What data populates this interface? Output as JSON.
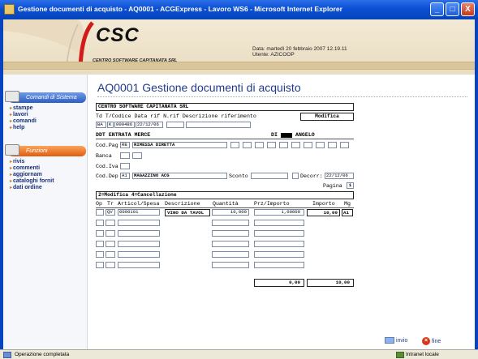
{
  "window": {
    "title": "Gestione documenti di acquisto - AQ0001 - ACGExpress - Lavoro WS6 - Microsoft Internet Explorer",
    "minimize": "_",
    "maximize": "□",
    "close": "X"
  },
  "header": {
    "logo": "CSC",
    "logo_sub": "CENTRO SOFTWARE CAPITANATA SRL",
    "date_line": "Data:    martedì 20 febbraio 2007 12.19.11",
    "user_line": "Utente: AZICOOP"
  },
  "sidebar": {
    "section1": "Comandi di Sistema",
    "links1": [
      "stampe",
      "lavori",
      "comandi",
      "help"
    ],
    "section2": "Funzioni",
    "links2": [
      "rivis",
      "commenti",
      "aggiornam",
      "cataloghi fornit",
      "dati ordine"
    ]
  },
  "main": {
    "title": "AQ0001 Gestione documenti di acquisto",
    "company": "CENTRO SOFTWARE CAPITANATA SRL",
    "doc_header_label": "Td T/Codice Data rif N.rif Descrizione riferimento",
    "mode": "Modifica",
    "doc_type": "BA",
    "doc_t": "K",
    "doc_code": "000486",
    "doc_date": "22/12/06",
    "causale": "DDT ENTRATA MERCE",
    "operator": "DI",
    "operator_name": "ANGELO",
    "cod_pag_label": "Cod.Pag",
    "cod_pag": "RB",
    "cod_pag_desc": "RIMESSA DIRETTA",
    "banca_label": "Banca",
    "cod_iva_label": "Cod.Iva",
    "cod_dep_label": "Cod.Dep",
    "cod_dep": "A1",
    "cod_dep_desc": "MAGAZZINO ACG",
    "sconto_label": "Sconto",
    "decorr_label": "Decorr:",
    "decorr_date": "22/12/06",
    "pagina_label": "Pagina",
    "pagina": "1",
    "options": "2=Modifica  4=Cancellazione",
    "columns": [
      "Op",
      "Tr",
      "Articol/Spesa",
      "Descrizione",
      "Quantità",
      "Prz/Importo",
      "Importo",
      "Mg"
    ],
    "row": {
      "tr": "QV",
      "article": "0000101",
      "description": "VINO DA TAVOL",
      "quantity": "10,000",
      "price": "1,00000",
      "amount": "10,00",
      "mg": "A1"
    },
    "total_left": "0,00",
    "total_right": "10,00",
    "invio": "invio",
    "fine": "fine"
  },
  "status": {
    "text": "Operazione completata",
    "zone": "Intranet locale"
  }
}
